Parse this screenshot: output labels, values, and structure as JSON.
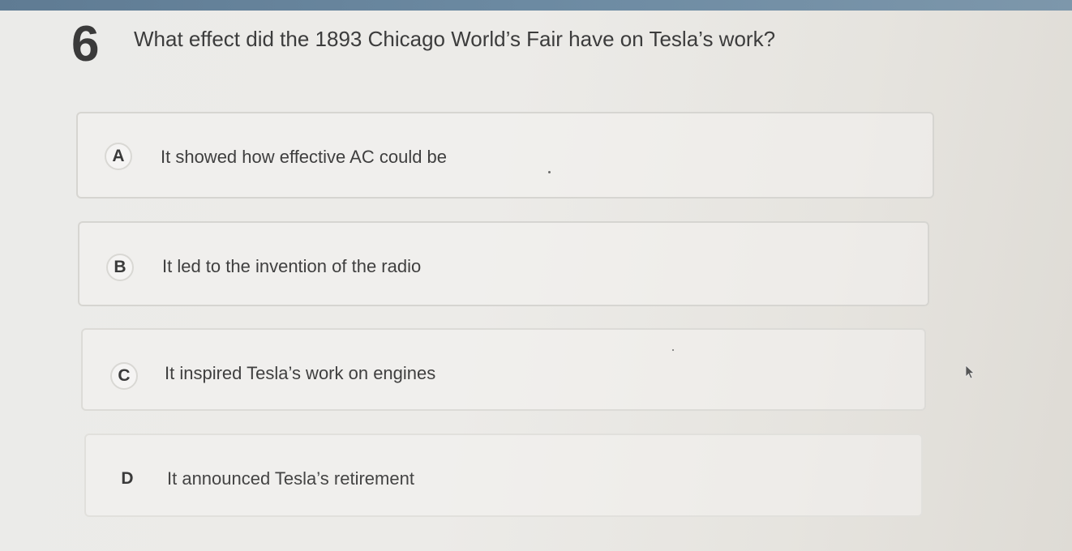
{
  "question": {
    "number": "6",
    "text": "What effect did the 1893 Chicago World’s Fair have on Tesla’s work?"
  },
  "options": [
    {
      "letter": "A",
      "text": "It showed how effective AC could be"
    },
    {
      "letter": "B",
      "text": "It led to the invention of the radio"
    },
    {
      "letter": "C",
      "text": "It inspired Tesla’s work on engines"
    },
    {
      "letter": "D",
      "text": "It announced Tesla’s retirement"
    }
  ],
  "colors": {
    "top_bar": "#6c8aa2",
    "background": "#ebebe9",
    "option_border": "#d6d5d1",
    "text": "#3b3b3b"
  },
  "icons": {
    "cursor": "mouse-pointer-arrow"
  }
}
